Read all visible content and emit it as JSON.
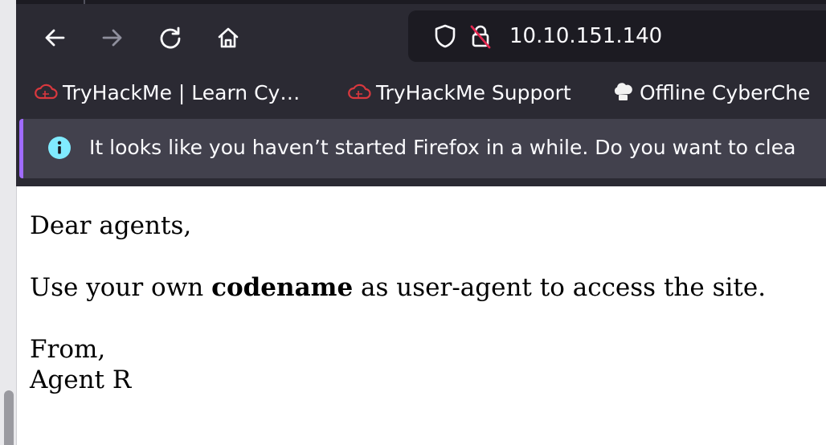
{
  "browser": {
    "url": "10.10.151.140",
    "nav_icons": [
      "back-arrow-icon",
      "forward-arrow-icon",
      "reload-icon",
      "home-icon"
    ],
    "url_icons": [
      "shield-icon",
      "insecure-lock-icon"
    ],
    "colors": {
      "toolbar": "#2b2a33",
      "urlbar": "#1c1b22",
      "notice": "#42414d",
      "notice_accent": "#a06bff",
      "info": "#80ebff",
      "tryhackme": "#d9383e"
    }
  },
  "bookmarks": [
    {
      "label": "TryHackMe | Learn Cy…",
      "icon": "tryhackme-cloud-icon"
    },
    {
      "label": "TryHackMe Support",
      "icon": "tryhackme-cloud-icon"
    },
    {
      "label": "Offline CyberChe",
      "icon": "chef-hat-icon"
    }
  ],
  "notification": {
    "icon": "info-icon",
    "text": "It looks like you haven’t started Firefox in a while. Do you want to clea"
  },
  "page": {
    "greeting": "Dear agents,",
    "instruction_before": "Use your own ",
    "instruction_bold": "codename",
    "instruction_after": " as user-agent to access the site.",
    "closing": "From,",
    "signature": "Agent R"
  }
}
